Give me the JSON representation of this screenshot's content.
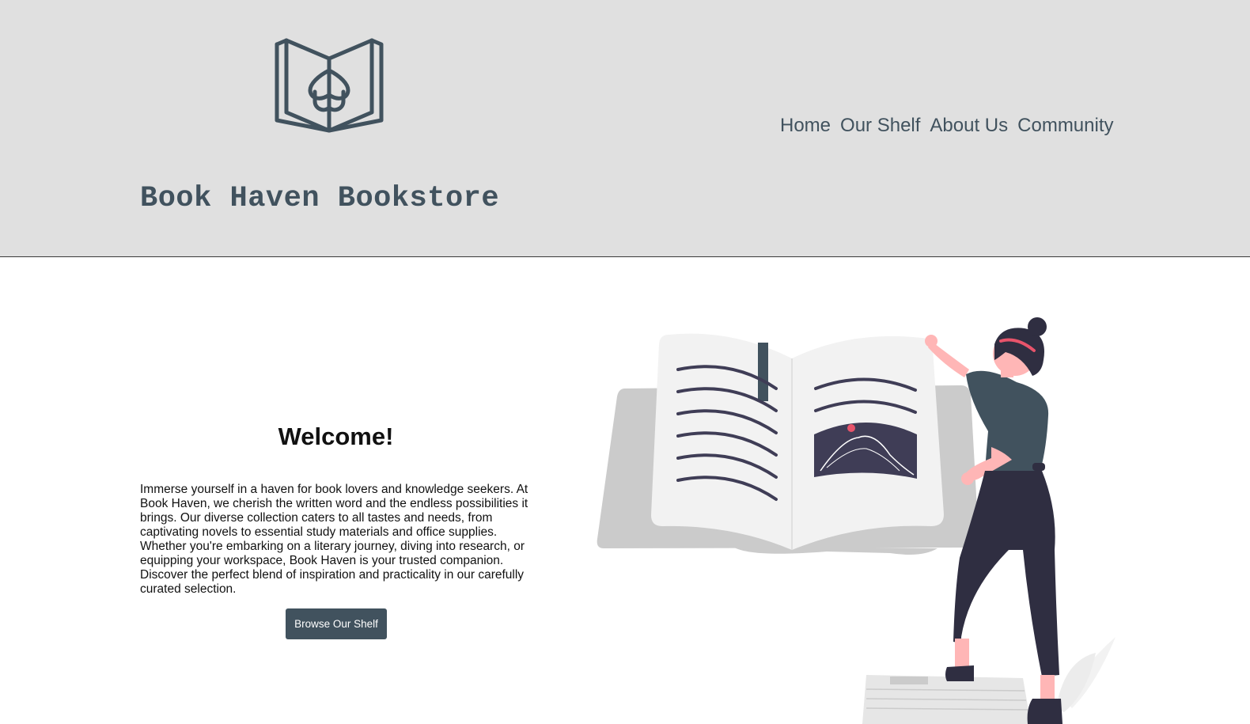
{
  "header": {
    "site_title": "Book Haven Bookstore",
    "logo_icon": "open-book-tulip-logo",
    "nav": [
      {
        "label": "Home"
      },
      {
        "label": "Our Shelf"
      },
      {
        "label": "About Us"
      },
      {
        "label": "Community"
      }
    ]
  },
  "main": {
    "welcome_title": "Welcome!",
    "welcome_text": "Immerse yourself in a haven for book lovers and knowledge seekers. At Book Haven, we cherish the written word and the endless possibilities it brings. Our diverse collection caters to all tastes and needs, from captivating novels to essential study materials and office supplies. Whether you're embarking on a literary journey, diving into research, or equipping your workspace, Book Haven is your trusted companion. Discover the perfect blend of inspiration and practicality in our carefully curated selection.",
    "browse_button": "Browse Our Shelf",
    "illustration_icon": "woman-reading-giant-book-illustration"
  },
  "colors": {
    "accent": "#41525e",
    "header_bg": "#e0e0e0",
    "page_bg": "#ffffff",
    "figure_dark": "#2f2e41",
    "figure_skin": "#ffb6b6",
    "highlight_pink": "#e8546b"
  }
}
